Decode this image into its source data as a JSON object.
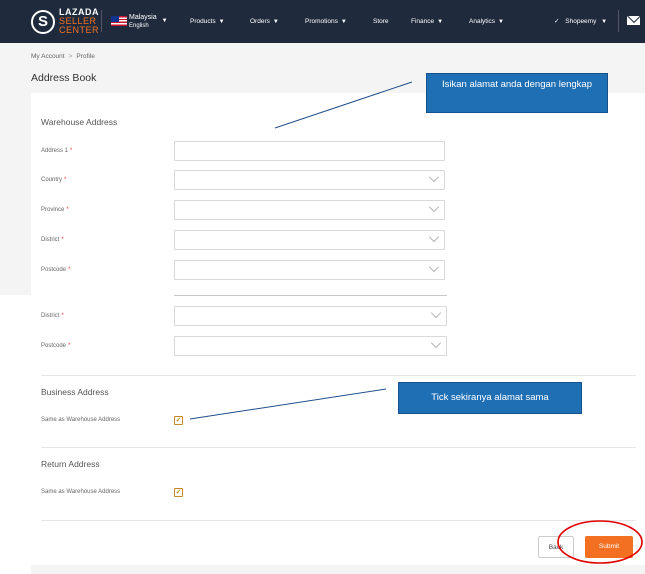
{
  "topbar": {
    "logo_mark": "S",
    "logo_line1": "LAZADA",
    "logo_line2": "SELLER",
    "logo_line3": "CENTER",
    "country": "Malaysia",
    "language": "English",
    "nav": [
      {
        "label": "Products"
      },
      {
        "label": "Orders"
      },
      {
        "label": "Promotions"
      },
      {
        "label": "Store"
      },
      {
        "label": "Finance"
      },
      {
        "label": "Analytics"
      }
    ],
    "user": "Shopeemy"
  },
  "breadcrumb": {
    "items": [
      "My Account",
      "Profile"
    ],
    "separator": ">"
  },
  "page_title": "Address Book",
  "warehouse": {
    "title": "Warehouse Address",
    "fields": [
      {
        "label": "Address 1",
        "required": "*",
        "value": ""
      },
      {
        "label": "Country",
        "required": "*",
        "value": ""
      },
      {
        "label": "Province",
        "required": "*",
        "value": ""
      },
      {
        "label": "District",
        "required": "*",
        "value": ""
      },
      {
        "label": "Postcode",
        "required": "*",
        "value": ""
      },
      {
        "label": "District",
        "required": "*",
        "value": ""
      },
      {
        "label": "Postcode",
        "required": "*",
        "value": ""
      }
    ]
  },
  "business": {
    "title": "Business Address",
    "same_label": "Same as Warehouse Address",
    "checked": true
  },
  "return": {
    "title": "Return Address",
    "same_label": "Same as Warehouse Address",
    "checked": true
  },
  "buttons": {
    "back": "Back",
    "submit": "Submit"
  },
  "annotations": {
    "note1": "Isikan alamat anda dengan lengkap",
    "note2": "Tick sekiranya alamat sama",
    "color": "#1f6fb5",
    "circle_color": "#e00000"
  },
  "colors": {
    "topbar": "#1f2b3d",
    "accent": "#f36f21",
    "checkbox": "#c38a25"
  }
}
